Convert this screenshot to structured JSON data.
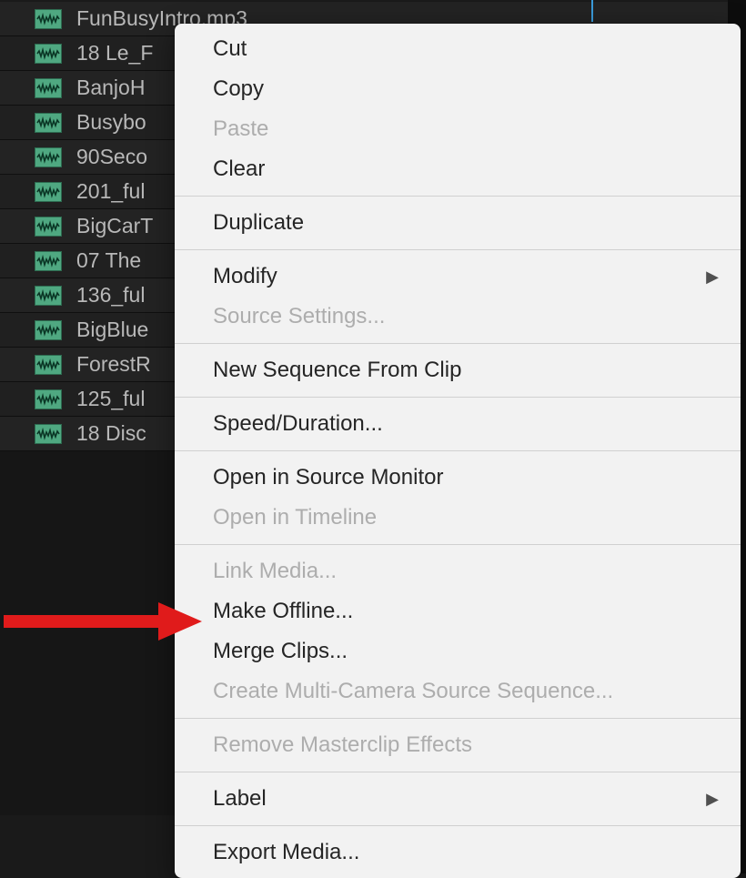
{
  "files": [
    {
      "name": "FunBusyIntro.mp3"
    },
    {
      "name": "18 Le_F"
    },
    {
      "name": "BanjoH"
    },
    {
      "name": "Busybo"
    },
    {
      "name": "90Seco"
    },
    {
      "name": "201_ful"
    },
    {
      "name": "BigCarT"
    },
    {
      "name": "07 The"
    },
    {
      "name": "136_ful"
    },
    {
      "name": "BigBlue"
    },
    {
      "name": "ForestR"
    },
    {
      "name": "125_ful"
    },
    {
      "name": "18 Disc"
    }
  ],
  "menu": {
    "groups": [
      [
        {
          "label": "Cut",
          "enabled": true
        },
        {
          "label": "Copy",
          "enabled": true
        },
        {
          "label": "Paste",
          "enabled": false
        },
        {
          "label": "Clear",
          "enabled": true
        }
      ],
      [
        {
          "label": "Duplicate",
          "enabled": true
        }
      ],
      [
        {
          "label": "Modify",
          "enabled": true,
          "submenu": true
        },
        {
          "label": "Source Settings...",
          "enabled": false
        }
      ],
      [
        {
          "label": "New Sequence From Clip",
          "enabled": true
        }
      ],
      [
        {
          "label": "Speed/Duration...",
          "enabled": true
        }
      ],
      [
        {
          "label": "Open in Source Monitor",
          "enabled": true
        },
        {
          "label": "Open in Timeline",
          "enabled": false
        }
      ],
      [
        {
          "label": "Link Media...",
          "enabled": false
        },
        {
          "label": "Make Offline...",
          "enabled": true
        },
        {
          "label": "Merge Clips...",
          "enabled": true
        },
        {
          "label": "Create Multi-Camera Source Sequence...",
          "enabled": false
        }
      ],
      [
        {
          "label": "Remove Masterclip Effects",
          "enabled": false
        }
      ],
      [
        {
          "label": "Label",
          "enabled": true,
          "submenu": true
        }
      ],
      [
        {
          "label": "Export Media...",
          "enabled": true
        }
      ]
    ]
  }
}
